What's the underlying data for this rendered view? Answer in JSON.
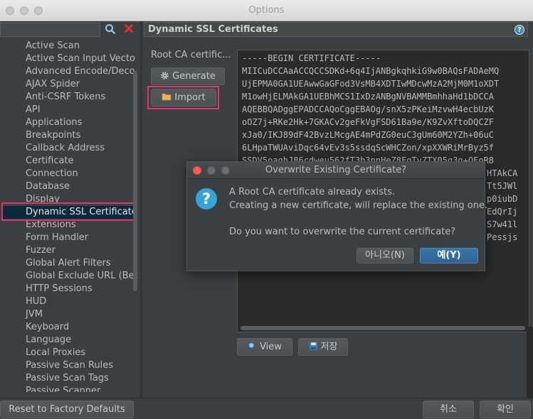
{
  "window": {
    "title": "Options"
  },
  "left_panel": {
    "search": {
      "value": "",
      "placeholder": ""
    },
    "tree_items": [
      "Active Scan",
      "Active Scan Input Vecto",
      "Advanced Encode/Deco",
      "AJAX Spider",
      "Anti-CSRF Tokens",
      "API",
      "Applications",
      "Breakpoints",
      "Callback Address",
      "Certificate",
      "Connection",
      "Database",
      "Display",
      "Dynamic SSL Certificate",
      "Extensions",
      "Form Handler",
      "Fuzzer",
      "Global Alert Filters",
      "Global Exclude URL (Bet",
      "HTTP Sessions",
      "HUD",
      "JVM",
      "Keyboard",
      "Language",
      "Local Proxies",
      "Passive Scan Rules",
      "Passive Scan Tags",
      "Passive Scanner"
    ],
    "selected_index": 13
  },
  "right_panel": {
    "title": "Dynamic SSL Certificates",
    "root_ca_label": "Root CA certific...",
    "generate_label": "Generate",
    "import_label": "Import",
    "certificate_lines": [
      "-----BEGIN CERTIFICATE-----",
      "MIICuDCCAaACCQCCSDKd+6q4IjANBgkqhkiG9w0BAQsFADAeMQ",
      "UjEPMA0GA1UEAwwGaGFod3VsMB4XDTIwMDcwMzA2MjM0M1oXDT",
      "M1owHjELMAkGA1UEBhMCS1IxDzANBgNVBAMMBmhhaHd1bDCCA",
      "AQEBBQADggEPADCCAQoCggEBAOg/snX5zPKeiMzvwH4ecbUzK",
      "oOZ7j+RKe2Hk+7GKACv2geFkVgFSD61Ba9e/K9ZvXftoDQCZF",
      "xJa0/IKJ89dF42BvzLMcgAE4mPdZG0euC3gUm60M2YZh+06uC",
      "6LHpaTWUAviDqc64vEv3s5ssdqScWHCZon/xpXXWRiMrByz5f",
      "SSDV5oaghJ86cdweu562fT3b3nnHeZ8FgTvZTX05g3g+OEoR8",
      "HTAkCA",
      "Tt5JWl",
      "p0iubD",
      "EdQrIj",
      "S7w41l",
      "Pessjs"
    ],
    "view_label": "View",
    "save_label": "저장"
  },
  "bottom_bar": {
    "reset_label": "Reset to Factory Defaults",
    "cancel_label": "취소",
    "ok_label": "확인"
  },
  "dialog": {
    "title": "Overwrite Existing Certificate?",
    "line1": "A Root CA certificate already exists.",
    "line2": "Creating a new certificate, will replace the existing one.",
    "line3": "Do you want to overwrite the current certificate?",
    "no_label": "아니오(N)",
    "yes_label": "예(Y)"
  },
  "colors": {
    "background": "#3c3f41",
    "selection": "#0d293e",
    "highlight_border": "#e2336b",
    "primary_button": "#2f6394",
    "question_icon": "#36a4d8"
  },
  "icons": {
    "search": "search-icon",
    "clear": "close-icon",
    "help": "help-icon",
    "generate": "gear-icon",
    "import": "folder-icon",
    "view": "magnifier-icon",
    "save": "save-icon",
    "dialog": "question-icon"
  }
}
